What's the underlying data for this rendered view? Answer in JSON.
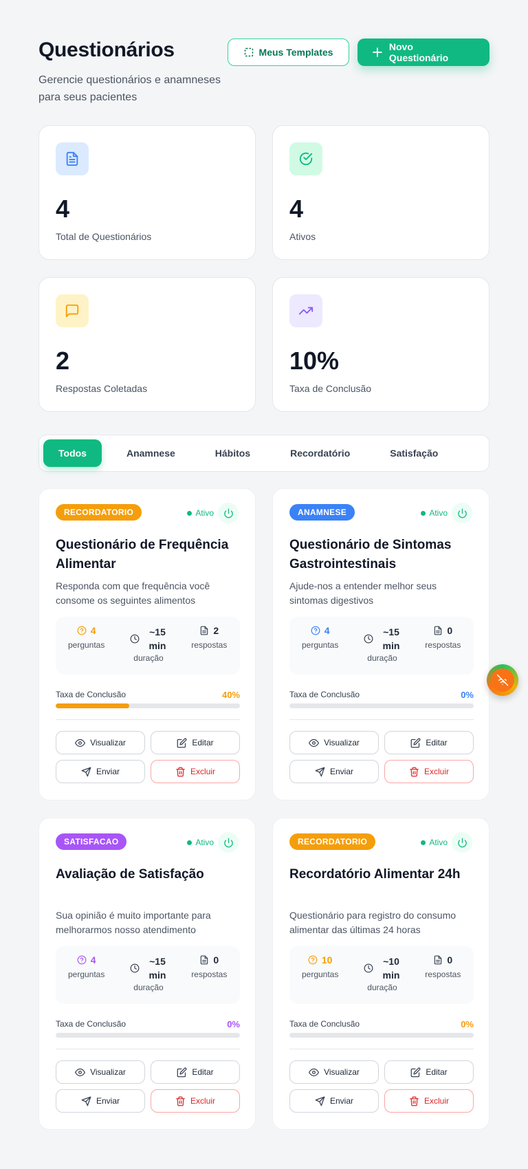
{
  "header": {
    "title": "Questionários",
    "subtitle": "Gerencie questionários e anamneses para seus pacientes",
    "templates_label": "Meus Templates",
    "new_label": "Novo Questionário"
  },
  "stats": [
    {
      "value": "4",
      "label": "Total de Questionários",
      "icon": "document-icon",
      "color": "#3b82f6",
      "bg": "#dbeafe"
    },
    {
      "value": "4",
      "label": "Ativos",
      "icon": "check-circle-icon",
      "color": "#10b981",
      "bg": "#d1fae5"
    },
    {
      "value": "2",
      "label": "Respostas Coletadas",
      "icon": "message-icon",
      "color": "#f59e0b",
      "bg": "#fef3c7"
    },
    {
      "value": "10%",
      "label": "Taxa de Conclusão",
      "icon": "trending-up-icon",
      "color": "#8b5cf6",
      "bg": "#ede9fe"
    }
  ],
  "tabs": [
    "Todos",
    "Anamnese",
    "Hábitos",
    "Recordatório",
    "Satisfação"
  ],
  "active_tab": "Todos",
  "labels": {
    "status": "Ativo",
    "perguntas": "perguntas",
    "duracao": "duração",
    "respostas": "respostas",
    "rate": "Taxa de Conclusão",
    "view": "Visualizar",
    "edit": "Editar",
    "send": "Enviar",
    "delete": "Excluir"
  },
  "cards": [
    {
      "badge": "RECORDATORIO",
      "badge_color": "#f59e0b",
      "accent": "#f59e0b",
      "title": "Questionário de Frequência Alimentar",
      "description": "Responda com que frequência você consome os seguintes alimentos",
      "questions": "4",
      "duration_top": "~15",
      "duration_unit": "min",
      "responses": "2",
      "rate": "40%",
      "rate_value": 40
    },
    {
      "badge": "ANAMNESE",
      "badge_color": "#3b82f6",
      "accent": "#3b82f6",
      "title": "Questionário de Sintomas Gastrointestinais",
      "description": "Ajude-nos a entender melhor seus sintomas digestivos",
      "questions": "4",
      "duration_top": "~15",
      "duration_unit": "min",
      "responses": "0",
      "rate": "0%",
      "rate_value": 0
    },
    {
      "badge": "SATISFACAO",
      "badge_color": "#a855f7",
      "accent": "#a855f7",
      "title": "Avaliação de Satisfação",
      "description": "Sua opinião é muito importante para melhorarmos nosso atendimento",
      "questions": "4",
      "duration_top": "~15",
      "duration_unit": "min",
      "responses": "0",
      "rate": "0%",
      "rate_value": 0
    },
    {
      "badge": "RECORDATORIO",
      "badge_color": "#f59e0b",
      "accent": "#f59e0b",
      "title": "Recordatório Alimentar 24h",
      "description": "Questionário para registro do consumo alimentar das últimas 24 horas",
      "questions": "10",
      "duration_top": "~10",
      "duration_unit": "min",
      "responses": "0",
      "rate": "0%",
      "rate_value": 0
    }
  ]
}
